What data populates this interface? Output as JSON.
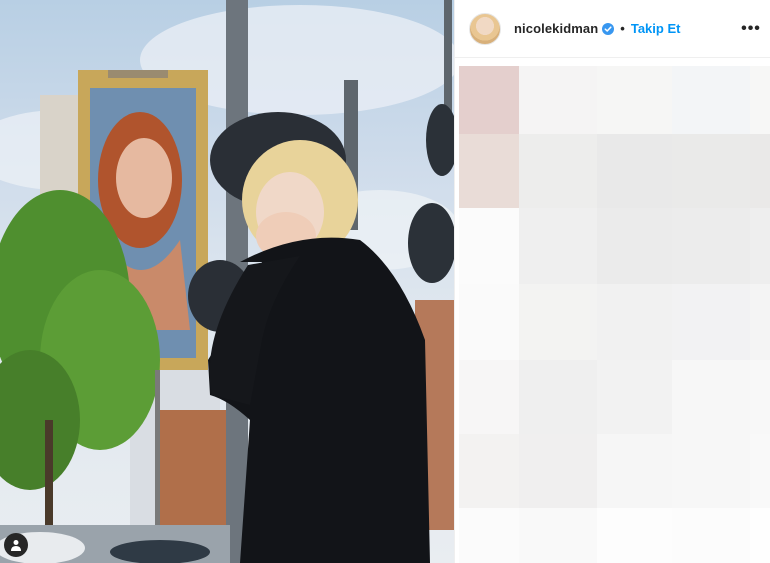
{
  "post": {
    "username": "nicolekidman",
    "separator": "•",
    "follow_label": "Takip Et",
    "more_label": "•••"
  },
  "icons": {
    "verified": "verified-badge-icon",
    "tag": "user-tag-icon",
    "more": "more-options-icon"
  },
  "colors": {
    "link": "#0095f6",
    "verified": "#3897f0",
    "text": "#262626"
  },
  "pixel_cells": [
    [
      "#e4cfcd",
      "#f5f4f4",
      "#f6f6f5",
      "#f3f5f7",
      "#f7f7f6"
    ],
    [
      "#e9dcd7",
      "#ededec",
      "#e9e9e9",
      "#eaeae9",
      "#eae9e8"
    ],
    [
      "#fbfbfb",
      "#efefef",
      "#ebebeb",
      "#ececec",
      "#eeeeee"
    ],
    [
      "#fafafa",
      "#f3f3f2",
      "#f1f1f1",
      "#f2f2f3",
      "#f4f4f4"
    ],
    [
      "#f7f6f6",
      "#efefef",
      "#f2f2f2",
      "#f7f7f7",
      "#f8f8f8"
    ],
    [
      "#f3f2f1",
      "#f0efef",
      "#f6f6f6",
      "#f7f7f7",
      "#f9f9f9"
    ],
    [
      "#fbfbfb",
      "#f9f9f9",
      "#fdfdfd",
      "#fcfcfc",
      "#fefefe"
    ]
  ]
}
